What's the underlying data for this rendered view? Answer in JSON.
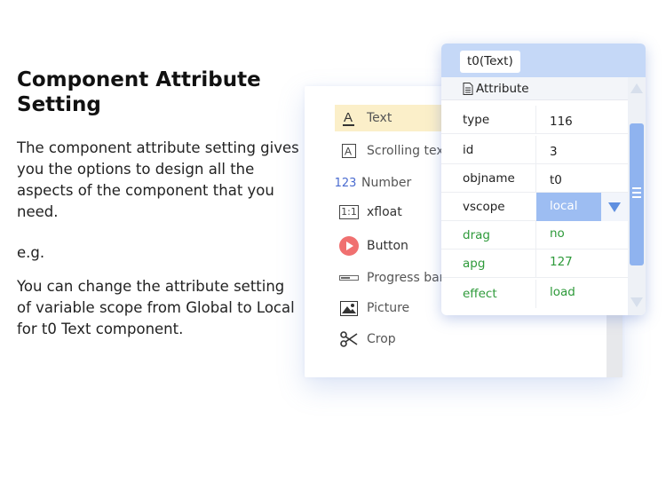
{
  "heading": "Component Attribute Setting",
  "description": "The component attribute setting gives you the options to design all the aspects of the component that you need.",
  "example_label": "e.g.",
  "note": "You can change the attribute setting of variable scope from Global to Local for t0 Text component.",
  "components": [
    {
      "label": "Text",
      "icon": "text-a-icon",
      "selected": true
    },
    {
      "label": "Scrolling text",
      "icon": "scrolling-text-icon"
    },
    {
      "label": "Number",
      "icon": "number-123-icon"
    },
    {
      "label": "xfloat",
      "icon": "xfloat-icon"
    },
    {
      "label": "Button",
      "icon": "play-button-icon"
    },
    {
      "label": "Progress bar",
      "icon": "progress-bar-icon"
    },
    {
      "label": "Picture",
      "icon": "picture-icon"
    },
    {
      "label": "Crop",
      "icon": "scissors-icon"
    }
  ],
  "attribute_panel": {
    "tab": "t0(Text)",
    "section": "Attribute",
    "rows": [
      {
        "key": "type",
        "value": "116"
      },
      {
        "key": "id",
        "value": "3"
      },
      {
        "key": "objname",
        "value": "t0"
      },
      {
        "key": "vscope",
        "value": "local"
      },
      {
        "key": "drag",
        "value": "no"
      },
      {
        "key": "apg",
        "value": "127"
      },
      {
        "key": "effect",
        "value": "load"
      }
    ]
  },
  "icon_glyphs": {
    "number": "123",
    "xfloat": "1:1"
  },
  "colors": {
    "accent_blue": "#9dbdf2",
    "header_blue": "#c5d8f7",
    "green_text": "#2e9a3a",
    "selected_bg": "#fbefc9",
    "button_red": "#f07070"
  }
}
